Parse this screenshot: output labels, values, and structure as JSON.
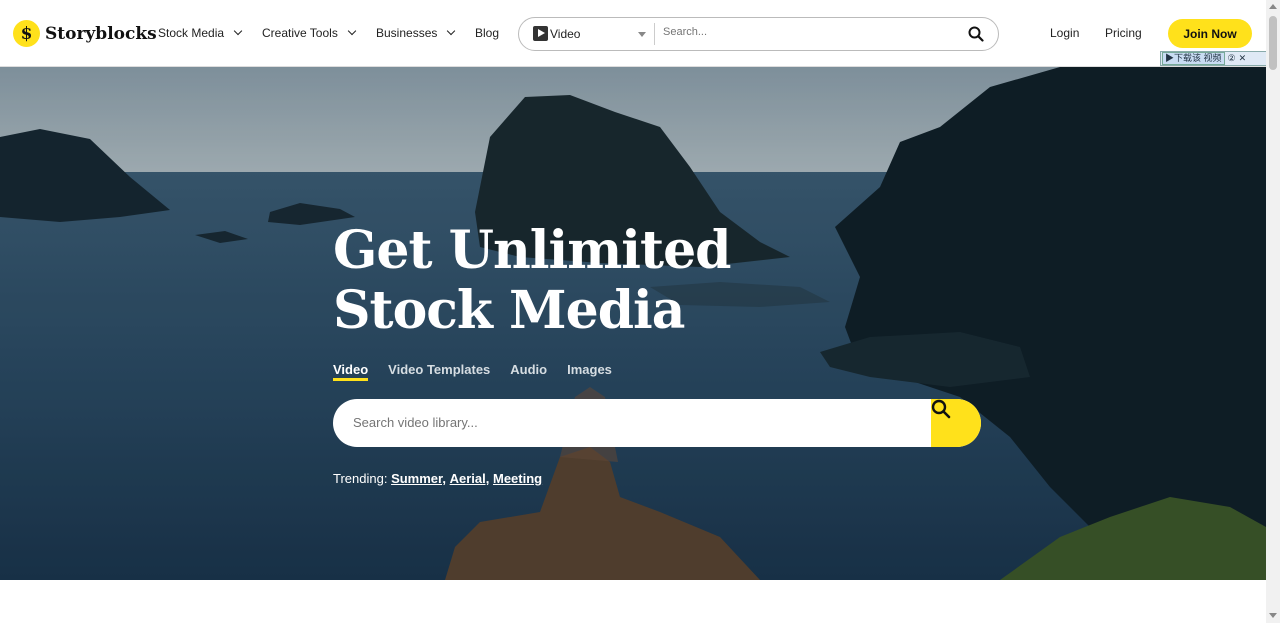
{
  "brand": {
    "name": "Storyblocks",
    "logo_mark": "$",
    "accent": "#ffe11b"
  },
  "nav": {
    "items": [
      {
        "label": "Stock Media",
        "dropdown": true
      },
      {
        "label": "Creative Tools",
        "dropdown": true
      },
      {
        "label": "Businesses",
        "dropdown": true
      },
      {
        "label": "Blog",
        "dropdown": false
      }
    ]
  },
  "header_search": {
    "type": "Video",
    "placeholder": "Search...",
    "icon": "search-icon"
  },
  "auth": {
    "login": "Login",
    "pricing": "Pricing",
    "join": "Join Now"
  },
  "download_bar": {
    "label": "下载该 视频",
    "help": "②",
    "close": "✕"
  },
  "hero": {
    "headline_line1": "Get Unlimited",
    "headline_line2": "Stock Media",
    "tabs": [
      {
        "label": "Video",
        "active": true
      },
      {
        "label": "Video Templates",
        "active": false
      },
      {
        "label": "Audio",
        "active": false
      },
      {
        "label": "Images",
        "active": false
      }
    ],
    "search_placeholder": "Search video library...",
    "trending_label": "Trending:",
    "trending": [
      "Summer,",
      "Aerial,",
      "Meeting"
    ]
  }
}
